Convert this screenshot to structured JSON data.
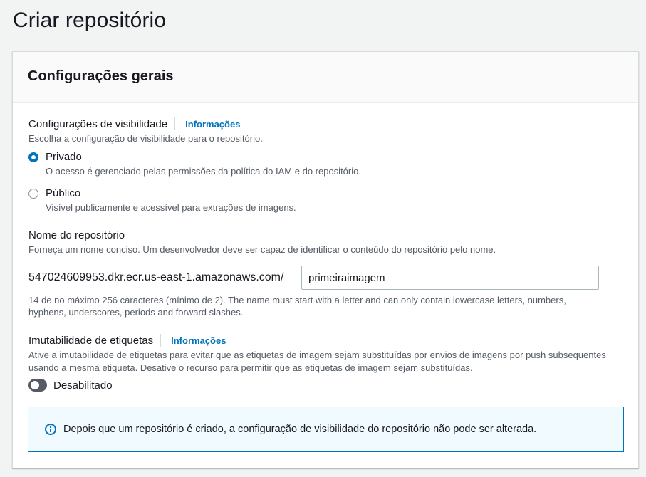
{
  "page": {
    "title": "Criar repositório"
  },
  "panel": {
    "title": "Configurações gerais",
    "visibility": {
      "label": "Configurações de visibilidade",
      "info": "Informações",
      "description": "Escolha a configuração de visibilidade para o repositório.",
      "options": [
        {
          "label": "Privado",
          "description": "O acesso é gerenciado pelas permissões da política do IAM e do repositório.",
          "checked": true
        },
        {
          "label": "Público",
          "description": "Visível publicamente e acessível para extrações de imagens.",
          "checked": false
        }
      ]
    },
    "repo_name": {
      "label": "Nome do repositório",
      "description": "Forneça um nome conciso. Um desenvolvedor deve ser capaz de identificar o conteúdo do repositório pelo nome.",
      "prefix": "547024609953.dkr.ecr.us-east-1.amazonaws.com/",
      "value": "primeiraimagem",
      "constraint_line1": "14 de no máximo 256 caracteres (mínimo de 2). The name must start with a letter and can only contain lowercase letters, numbers,",
      "constraint_line2": "hyphens, underscores, periods and forward slashes."
    },
    "tag_immutability": {
      "label": "Imutabilidade de etiquetas",
      "info": "Informações",
      "description_line1": "Ative a imutabilidade de etiquetas para evitar que as etiquetas de imagem sejam substituídas por envios de imagens por push subsequentes",
      "description_line2": "usando a mesma etiqueta. Desative o recurso para permitir que as etiquetas de imagem sejam substituídas.",
      "toggle_label": "Desabilitado",
      "enabled": false
    },
    "alert": {
      "icon": "info-icon",
      "text": "Depois que um repositório é criado, a configuração de visibilidade do repositório não pode ser alterada."
    }
  },
  "colors": {
    "accent": "#0073bb",
    "alert_bg": "#f1faff",
    "toggle_off": "#545b64",
    "page_bg": "#f2f3f3"
  }
}
